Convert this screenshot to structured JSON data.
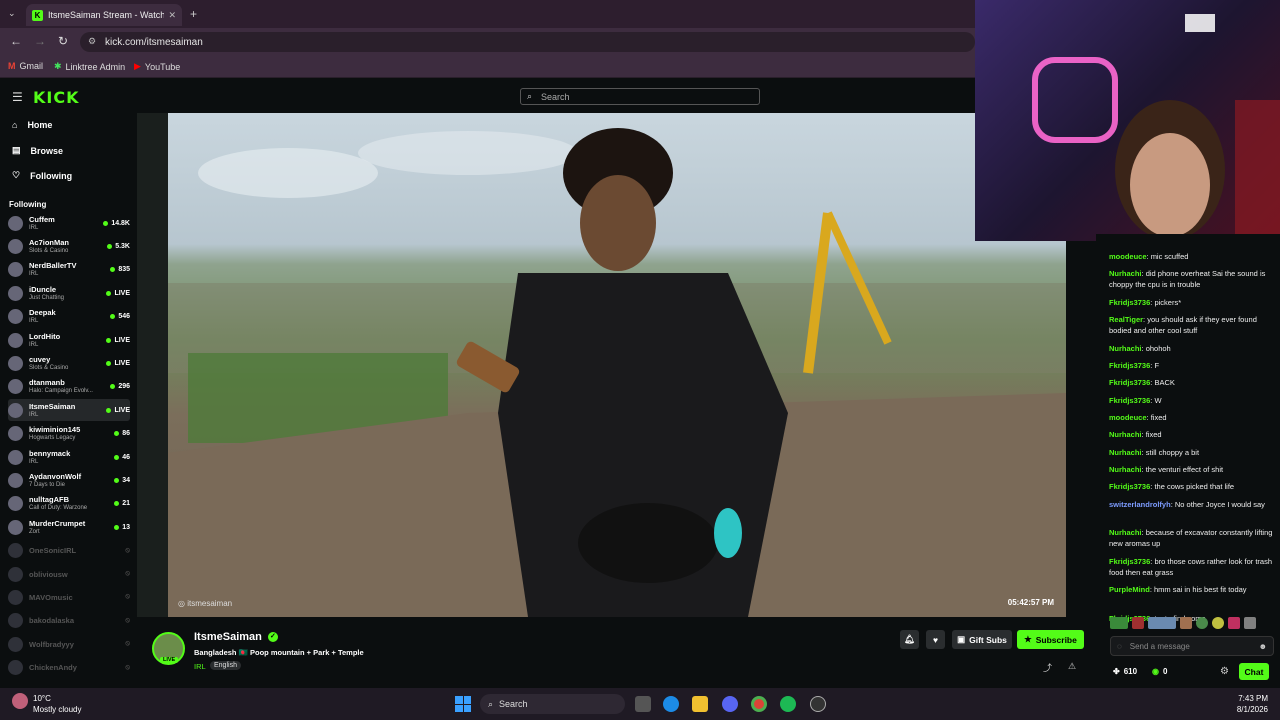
{
  "browser": {
    "tab_title": "ItsmeSaiman Stream - Watch Li",
    "url": "kick.com/itsmesaiman",
    "bookmarks": [
      "Gmail",
      "Linktree Admin",
      "YouTube"
    ]
  },
  "header": {
    "logo": "KICK",
    "search_placeholder": "Search"
  },
  "nav": {
    "home": "Home",
    "browse": "Browse",
    "following": "Following"
  },
  "following_title": "Following",
  "following": [
    {
      "name": "Cuffem",
      "category": "IRL",
      "count": "14.8K",
      "live": true
    },
    {
      "name": "Ac7ionMan",
      "category": "Slots & Casino",
      "count": "5.3K",
      "live": true
    },
    {
      "name": "NerdBallerTV",
      "category": "IRL",
      "count": "835",
      "live": true
    },
    {
      "name": "iDuncle",
      "category": "Just Chatting",
      "count": "LIVE",
      "live": true
    },
    {
      "name": "Deepak",
      "category": "IRL",
      "count": "546",
      "live": true
    },
    {
      "name": "LordHito",
      "category": "IRL",
      "count": "LIVE",
      "live": true
    },
    {
      "name": "cuvey",
      "category": "Slots & Casino",
      "count": "LIVE",
      "live": true
    },
    {
      "name": "dtanmanb",
      "category": "Halo: Campaign Evolv...",
      "count": "296",
      "live": true
    },
    {
      "name": "ItsmeSaiman",
      "category": "IRL",
      "count": "LIVE",
      "live": true
    },
    {
      "name": "kiwiminion145",
      "category": "Hogwarts Legacy",
      "count": "86",
      "live": true
    },
    {
      "name": "bennymack",
      "category": "IRL",
      "count": "46",
      "live": true
    },
    {
      "name": "AydanvonWolf",
      "category": "7 Days to Die",
      "count": "34",
      "live": true
    },
    {
      "name": "nulltagAFB",
      "category": "Call of Duty: Warzone",
      "count": "21",
      "live": true
    },
    {
      "name": "MurderCrumpet",
      "category": "Zort",
      "count": "13",
      "live": true
    },
    {
      "name": "OneSonicIRL",
      "category": "",
      "count": "",
      "live": false
    },
    {
      "name": "obliviousw",
      "category": "",
      "count": "",
      "live": false
    },
    {
      "name": "MAVOmusic",
      "category": "",
      "count": "",
      "live": false
    },
    {
      "name": "bakodalaska",
      "category": "",
      "count": "",
      "live": false
    },
    {
      "name": "Wolfbradyyy",
      "category": "",
      "count": "",
      "live": false
    },
    {
      "name": "ChickenAndy",
      "category": "",
      "count": "",
      "live": false
    }
  ],
  "video": {
    "watermark": "itsmesaiman",
    "timestamp": "05:42:57 PM"
  },
  "stream": {
    "name": "ItsmeSaiman",
    "live_badge": "LIVE",
    "title": "Bangladesh 🇧🇩 Poop mountain + Park + Temple",
    "category": "IRL",
    "tag": "English",
    "gift": "Gift Subs",
    "subscribe": "Subscribe"
  },
  "chat": {
    "messages": [
      {
        "user": "moodeuce",
        "text": "mic scuffed",
        "color": "#53fc18"
      },
      {
        "user": "Nurhachi",
        "text": "did phone overheat Sai the sound is choppy the cpu is in trouble",
        "color": "#53fc18"
      },
      {
        "user": "Fkridjs3736",
        "text": "pickers*",
        "color": "#53fc18"
      },
      {
        "user": "RealTiger",
        "text": "you should ask if they ever found bodied and other cool stuff",
        "color": "#53fc18"
      },
      {
        "user": "Nurhachi",
        "text": "ohohoh",
        "color": "#53fc18"
      },
      {
        "user": "Fkridjs3736",
        "text": "F",
        "color": "#53fc18"
      },
      {
        "user": "Fkridjs3736",
        "text": "BACK",
        "color": "#53fc18"
      },
      {
        "user": "Fkridjs3736",
        "text": "W",
        "color": "#53fc18"
      },
      {
        "user": "moodeuce",
        "text": "fixed",
        "color": "#53fc18"
      },
      {
        "user": "Nurhachi",
        "text": "fixed",
        "color": "#53fc18"
      },
      {
        "user": "Nurhachi",
        "text": "still choppy a bit",
        "color": "#53fc18"
      },
      {
        "user": "Nurhachi",
        "text": "the venturi effect of shit",
        "color": "#53fc18"
      },
      {
        "user": "Fkridjs3736",
        "text": "the cows picked that life",
        "color": "#53fc18"
      },
      {
        "user": "switzerlandrolfyh",
        "text": "No other Joyce I would say",
        "color": "#7d9cff"
      },
      {
        "user": "Nurhachi",
        "text": "because of excavator constantly lifting new aromas up",
        "color": "#53fc18"
      },
      {
        "user": "Fkridjs3736",
        "text": "bro those cows rather look for trash food then eat grass",
        "color": "#53fc18"
      },
      {
        "user": "PurpleMind",
        "text": "hmm sai in his best fit today",
        "color": "#53fc18"
      },
      {
        "user": "Fkridjs3736",
        "text": "try to find some",
        "color": "#53fc18"
      }
    ],
    "input_placeholder": "Send a message",
    "points": "610",
    "second_count": "0",
    "chat_button": "Chat"
  },
  "taskbar": {
    "temp": "10°C",
    "weather": "Mostly cloudy",
    "search": "Search",
    "time": "7:43 PM",
    "date": "8/1/2026"
  }
}
